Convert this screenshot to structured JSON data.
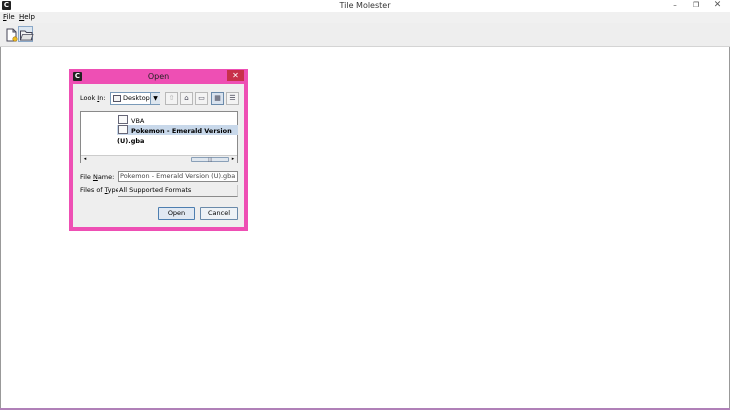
{
  "window": {
    "title": "Tile Molester",
    "app_icon": "C",
    "controls": {
      "minimize": "–",
      "maximize": "❐",
      "close": "✕"
    }
  },
  "menubar": {
    "file": {
      "mnemonic": "F",
      "rest": "ile"
    },
    "help": {
      "mnemonic": "H",
      "rest": "elp"
    }
  },
  "toolbar": {
    "icons": [
      "new-file-icon",
      "open-folder-icon"
    ]
  },
  "dialog": {
    "title": "Open",
    "icon": "C",
    "close_glyph": "✕",
    "accent_color": "#ee4fb4",
    "look_in": {
      "label_pre": "Look ",
      "mnemonic": "I",
      "label_post": "n:",
      "value": "Desktop",
      "arrow": "▼"
    },
    "nav_buttons": {
      "up": "⇧",
      "home": "⌂",
      "new_folder": "▭",
      "list": "▦",
      "details": "☰"
    },
    "files": [
      {
        "name": "VBA",
        "type": "folder"
      },
      {
        "name": "Pokemon - Emerald Version (U).gba",
        "type": "file",
        "selected": true
      }
    ],
    "scrollbar": {
      "left": "◂",
      "right": "▸",
      "grip": "|||"
    },
    "file_name": {
      "label_pre": "File ",
      "mnemonic": "N",
      "label_post": "ame:",
      "value": "Pokemon - Emerald Version (U).gba"
    },
    "files_of_type": {
      "label_pre": "Files of ",
      "mnemonic": "T",
      "label_post": "ype:",
      "value": "All Supported Formats"
    },
    "buttons": {
      "open": "Open",
      "cancel": "Cancel"
    }
  }
}
